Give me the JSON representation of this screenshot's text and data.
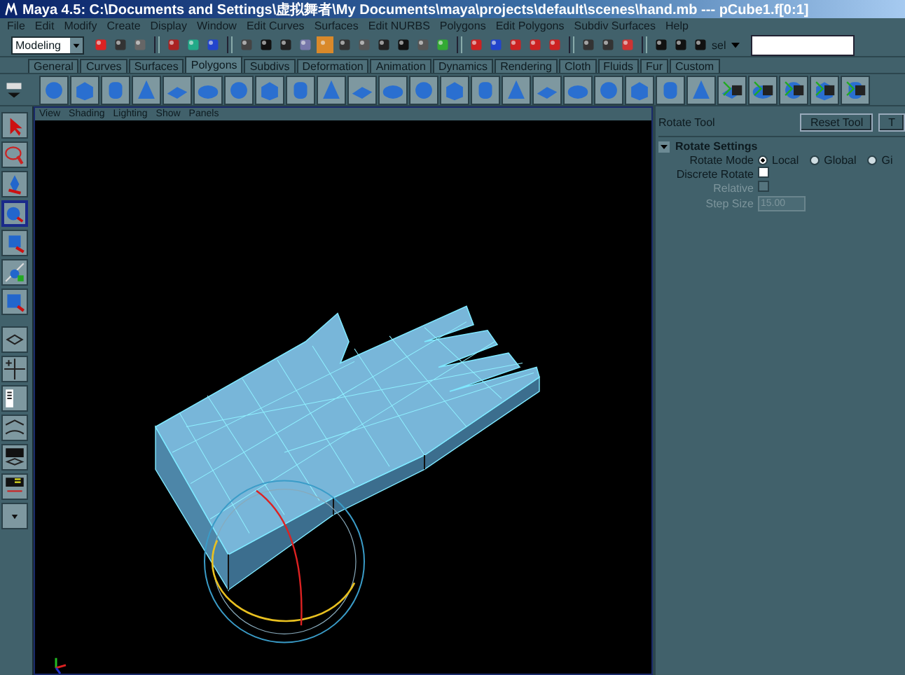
{
  "window": {
    "title": "Maya 4.5: C:\\Documents and Settings\\虚拟舞者\\My Documents\\maya\\projects\\default\\scenes\\hand.mb  ---  pCube1.f[0:1]"
  },
  "menu_bar": [
    "File",
    "Edit",
    "Modify",
    "Create",
    "Display",
    "Window",
    "Edit Curves",
    "Surfaces",
    "Edit NURBS",
    "Polygons",
    "Edit Polygons",
    "Subdiv Surfaces",
    "Help"
  ],
  "status_line": {
    "mode_menu": "Modeling",
    "selection_label": "sel"
  },
  "shelf": {
    "tabs": [
      {
        "label": "General",
        "selected": false
      },
      {
        "label": "Curves",
        "selected": false
      },
      {
        "label": "Surfaces",
        "selected": false
      },
      {
        "label": "Polygons",
        "selected": true
      },
      {
        "label": "Subdivs",
        "selected": false
      },
      {
        "label": "Deformation",
        "selected": false
      },
      {
        "label": "Animation",
        "selected": false
      },
      {
        "label": "Dynamics",
        "selected": false
      },
      {
        "label": "Rendering",
        "selected": false
      },
      {
        "label": "Cloth",
        "selected": false
      },
      {
        "label": "Fluids",
        "selected": false
      },
      {
        "label": "Fur",
        "selected": false
      },
      {
        "label": "Custom",
        "selected": false
      }
    ]
  },
  "viewport": {
    "menu": [
      "View",
      "Shading",
      "Lighting",
      "Show",
      "Panels"
    ]
  },
  "tool_settings": {
    "title": "Rotate Tool",
    "buttons": [
      "Reset Tool",
      "T"
    ],
    "section": {
      "label": "Rotate Settings",
      "expanded": true
    },
    "rotate_mode": {
      "label": "Rotate Mode",
      "options": [
        {
          "label": "Local",
          "selected": true
        },
        {
          "label": "Global",
          "selected": false
        },
        {
          "label": "Gi",
          "selected": false
        }
      ]
    },
    "discrete_rotate": {
      "label": "Discrete Rotate",
      "checked": false
    },
    "relative": {
      "label": "Relative",
      "checked": false,
      "disabled": true
    },
    "step_size": {
      "label": "Step Size",
      "value": "15.00",
      "disabled": true
    }
  }
}
